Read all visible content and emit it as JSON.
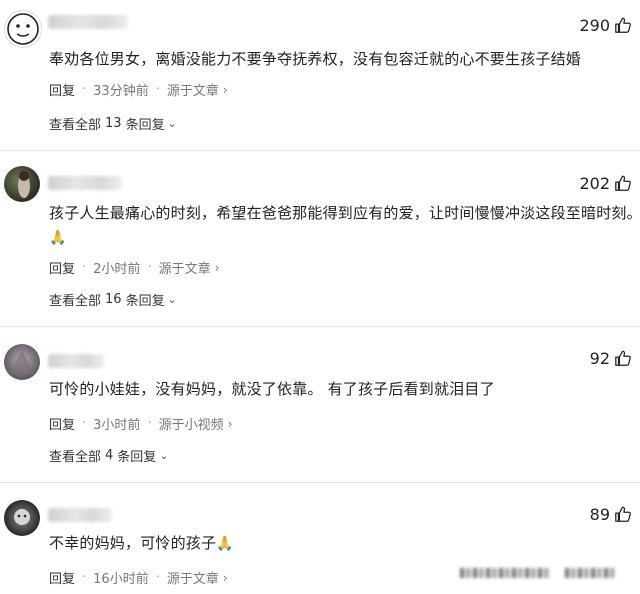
{
  "comments": [
    {
      "likes": "290",
      "text": "奉劝各位男女，离婚没能力不要争夺抚养权，没有包容迁就的心不要生孩子结婚",
      "reply_label": "回复",
      "time": "33分钟前",
      "source": "源于文章",
      "view_all": {
        "prefix": "查看全部",
        "count": "13",
        "suffix": "条回复"
      }
    },
    {
      "likes": "202",
      "text": "孩子人生最痛心的时刻，希望在爸爸那能得到应有的爱，让时间慢慢冲淡这段至暗时刻。",
      "emoji": "🙏",
      "reply_label": "回复",
      "time": "2小时前",
      "source": "源于文章",
      "view_all": {
        "prefix": "查看全部",
        "count": "16",
        "suffix": "条回复"
      }
    },
    {
      "likes": "92",
      "text": "可怜的小娃娃，没有妈妈，就没了依靠。 有了孩子后看到就泪目了",
      "reply_label": "回复",
      "time": "3小时前",
      "source": "源于小视频",
      "view_all": {
        "prefix": "查看全部",
        "count": "4",
        "suffix": "条回复"
      }
    },
    {
      "likes": "89",
      "text": "不幸的妈妈，可怜的孩子",
      "emoji": "🙏",
      "reply_label": "回复",
      "time": "16小时前",
      "source": "源于文章"
    }
  ],
  "icons": {
    "like": "thumbs-up-icon",
    "chevron_right": "chevron-right-icon",
    "chevron_down": "chevron-down-icon"
  },
  "colors": {
    "text": "#222222",
    "meta": "#777777",
    "divider": "#e3e3e3"
  }
}
